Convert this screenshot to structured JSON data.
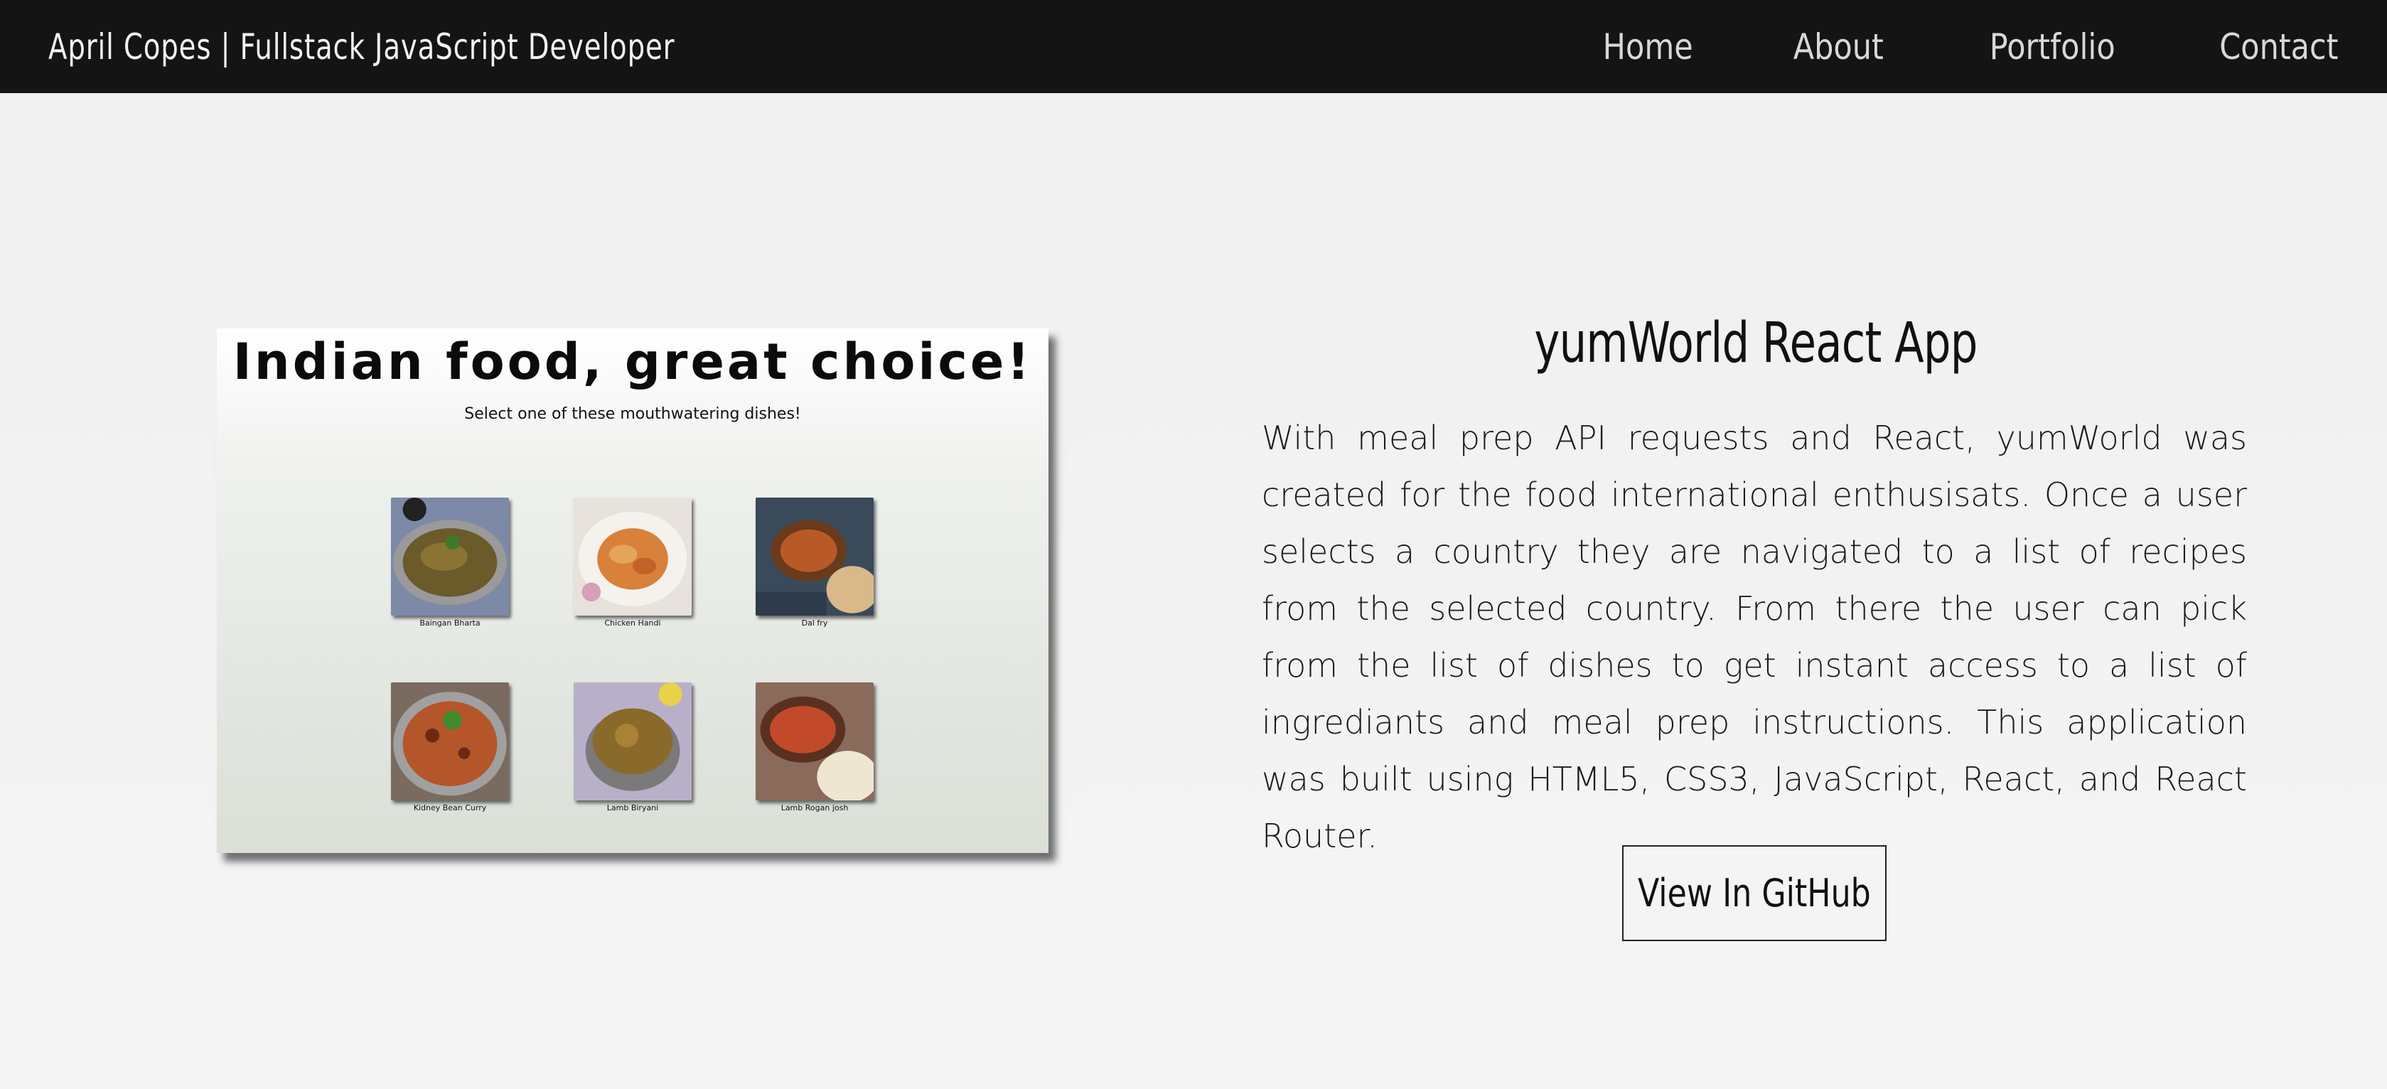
{
  "header": {
    "brand": "April Copes | Fullstack JavaScript Developer",
    "nav": [
      {
        "label": "Home"
      },
      {
        "label": "About"
      },
      {
        "label": "Portfolio"
      },
      {
        "label": "Contact"
      }
    ]
  },
  "preview": {
    "heading": "Indian food, great choice!",
    "subheading": "Select one of these mouthwatering dishes!",
    "dishes": [
      {
        "name": "Baingan Bharta"
      },
      {
        "name": "Chicken Handi"
      },
      {
        "name": "Dal fry"
      },
      {
        "name": "Kidney Bean Curry"
      },
      {
        "name": "Lamb Biryani"
      },
      {
        "name": "Lamb Rogan josh"
      }
    ]
  },
  "project": {
    "title": "yumWorld React App",
    "description": "With meal prep API requests and React, yumWorld was created for the food international enthusisats. Once a user selects a country they are navigated to a list of recipes from the selected country. From there the user can pick from the list of dishes to get instant access to a list of ingrediants and meal prep instructions. This application was built using HTML5, CSS3, JavaScript, React, and React Router.",
    "button_label": "View In GitHub"
  },
  "colors": {
    "navbar_bg": "#141414",
    "page_bg": "#f2f2f2",
    "text": "#111111"
  }
}
